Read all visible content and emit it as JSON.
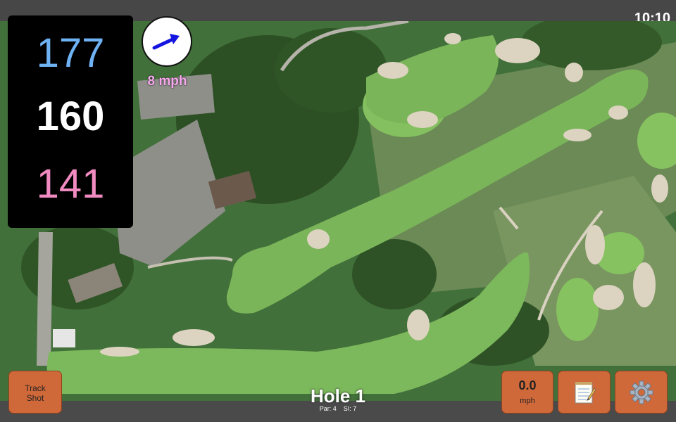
{
  "status_bar": {
    "time": "10:10"
  },
  "distances": {
    "back": "177",
    "middle": "160",
    "front": "141"
  },
  "wind": {
    "speed": "8 mph",
    "arrow_color": "#1515e0"
  },
  "hole": {
    "title": "Hole 1",
    "par_label": "Par: 4",
    "si_label": "SI: 7"
  },
  "buttons": {
    "track_shot_line1": "Track",
    "track_shot_line2": "Shot",
    "speed_value": "0.0",
    "speed_unit": "mph",
    "notes_icon": "notepad-icon",
    "settings_icon": "gear-icon"
  },
  "colors": {
    "button": "#d0693a",
    "back_distance": "#6fb2f4",
    "front_distance": "#f08ac0",
    "wind_label": "#f7a8ee"
  }
}
